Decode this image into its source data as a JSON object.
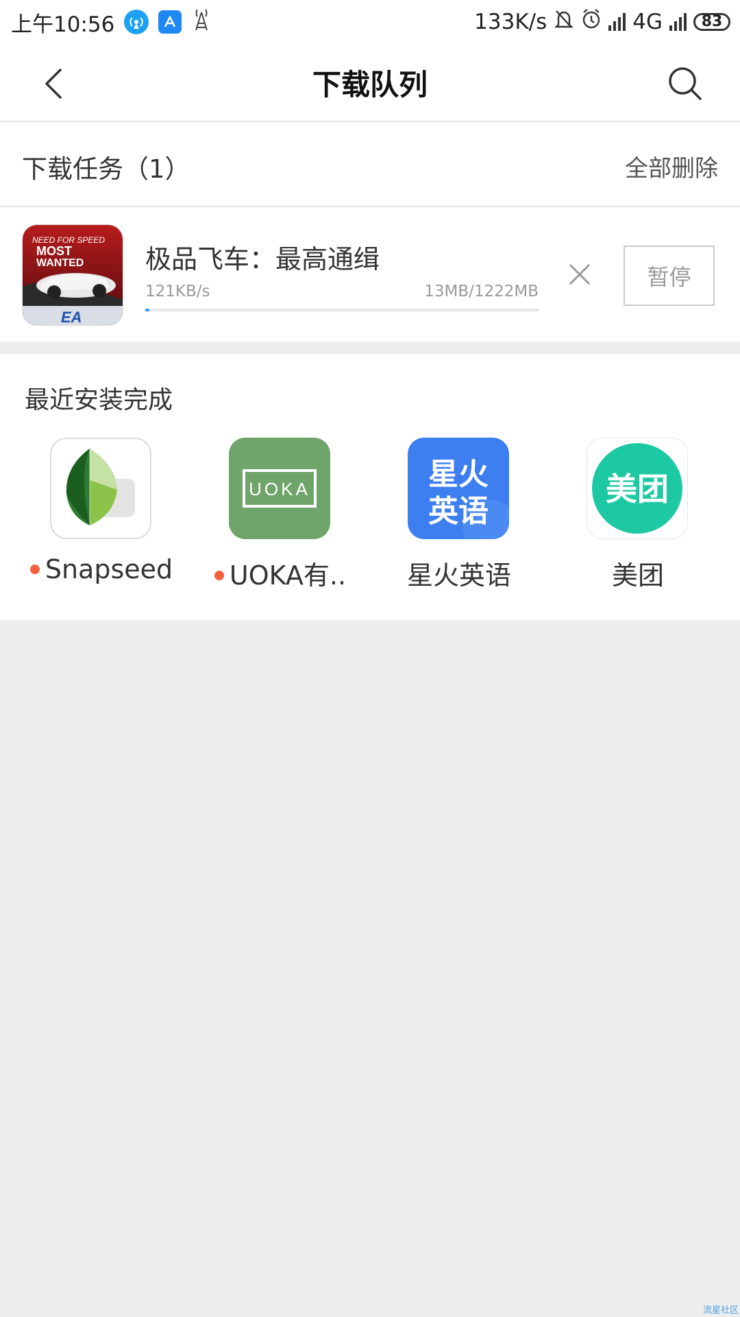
{
  "status_bar": {
    "time": "上午10:56",
    "net_speed": "133K/s",
    "network": "4G",
    "battery": "83"
  },
  "header": {
    "title": "下载队列"
  },
  "downloads": {
    "section_title": "下载任务（1）",
    "delete_all_label": "全部删除",
    "tasks": [
      {
        "name": "极品飞车：最高通缉",
        "speed": "121KB/s",
        "size": "13MB/1222MB",
        "progress": 0.0106,
        "pause_label": "暂停"
      }
    ]
  },
  "recent": {
    "title": "最近安装完成",
    "apps": [
      {
        "label": "Snapseed",
        "new": true,
        "icon": "snapseed-icon"
      },
      {
        "label": "UOKA有..",
        "new": true,
        "icon": "uoka-icon"
      },
      {
        "label": "星火英语",
        "new": false,
        "icon": "xinghuo-icon",
        "icon_text": "星火\n英语"
      },
      {
        "label": "美团",
        "new": false,
        "icon": "meituan-icon",
        "icon_text": "美团"
      }
    ]
  },
  "watermark": "流星社区",
  "colors": {
    "accent_blue": "#2196f3",
    "new_dot": "#f56040",
    "meituan_green": "#1dc9a3",
    "uoka_green": "#6fa46a",
    "xinghuo_blue": "#3d7ef0"
  }
}
